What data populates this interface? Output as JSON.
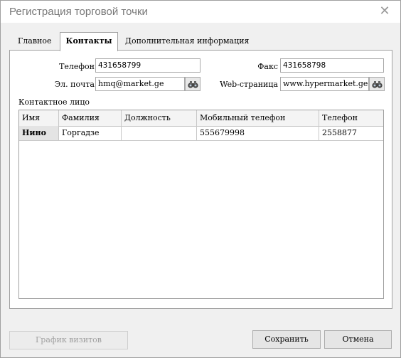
{
  "window": {
    "title": "Регистрация торговой точки",
    "close_glyph": "✕"
  },
  "tabs": [
    {
      "label": "Главное",
      "active": false
    },
    {
      "label": "Контакты",
      "active": true
    },
    {
      "label": "Дополнительная информация",
      "active": false
    }
  ],
  "contacts": {
    "phone_label": "Телефон",
    "phone_value": "431658799",
    "fax_label": "Факс",
    "fax_value": "431658798",
    "email_label": "Эл. почта",
    "email_value": "hmq@market.ge",
    "web_label": "Web-страница",
    "web_value": "www.hypermarket.ge",
    "lookup_icon": "binoculars-icon"
  },
  "contact_person": {
    "section_label": "Контактное лицо",
    "columns": [
      "Имя",
      "Фамилия",
      "Должность",
      "Мобильный телефон",
      "Телефон"
    ],
    "rows": [
      [
        "Нино",
        "Горгадзе",
        "",
        "555679998",
        "2558877"
      ]
    ]
  },
  "footer": {
    "visits_label": "График визитов",
    "save_label": "Сохранить",
    "cancel_label": "Отмена"
  }
}
